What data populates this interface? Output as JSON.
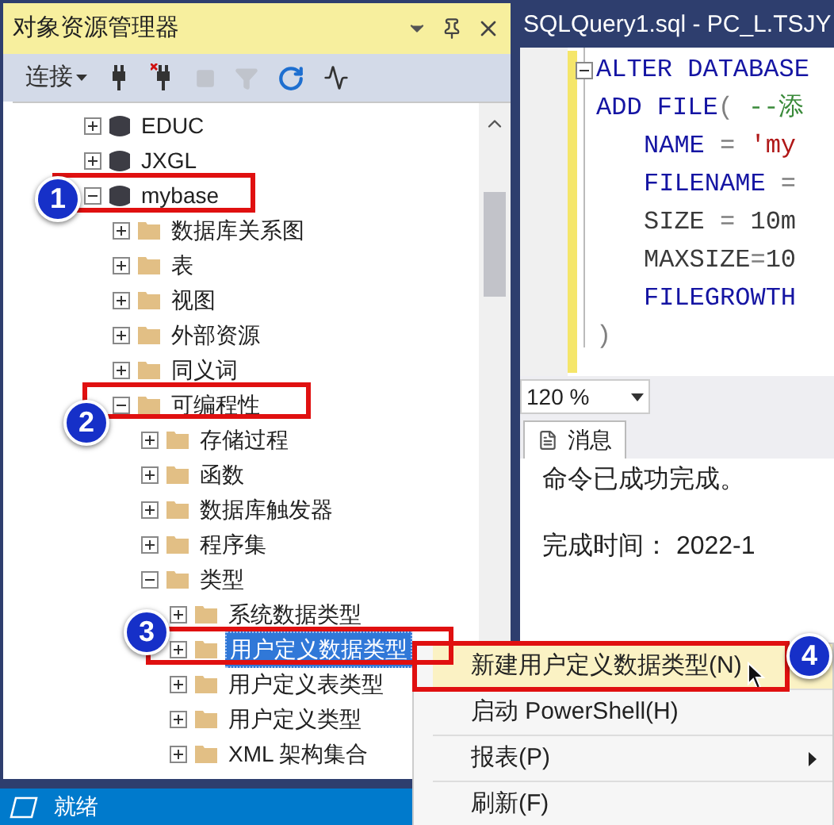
{
  "object_explorer": {
    "title": "对象资源管理器",
    "toolbar": {
      "connect_label": "连接",
      "tools": [
        {
          "kind": "connect",
          "disabled": false
        },
        {
          "kind": "disconnect",
          "disabled": false
        },
        {
          "kind": "stop",
          "disabled": true
        },
        {
          "kind": "filter",
          "disabled": true
        },
        {
          "kind": "refresh",
          "disabled": false
        },
        {
          "kind": "activity",
          "disabled": false
        }
      ]
    },
    "tree": [
      {
        "label": "EDUC",
        "kind": "database",
        "expanded": false,
        "selected": false
      },
      {
        "label": "JXGL",
        "kind": "database",
        "expanded": false,
        "selected": false
      },
      {
        "label": "mybase",
        "kind": "database",
        "expanded": true,
        "selected": false,
        "children": [
          {
            "label": "数据库关系图",
            "kind": "folder",
            "expanded": false,
            "selected": false
          },
          {
            "label": "表",
            "kind": "folder",
            "expanded": false,
            "selected": false
          },
          {
            "label": "视图",
            "kind": "folder",
            "expanded": false,
            "selected": false
          },
          {
            "label": "外部资源",
            "kind": "folder",
            "expanded": false,
            "selected": false
          },
          {
            "label": "同义词",
            "kind": "folder",
            "expanded": false,
            "selected": false
          },
          {
            "label": "可编程性",
            "kind": "folder",
            "expanded": true,
            "selected": false,
            "children": [
              {
                "label": "存储过程",
                "kind": "folder",
                "expanded": false,
                "selected": false
              },
              {
                "label": "函数",
                "kind": "folder",
                "expanded": false,
                "selected": false
              },
              {
                "label": "数据库触发器",
                "kind": "folder",
                "expanded": false,
                "selected": false
              },
              {
                "label": "程序集",
                "kind": "folder",
                "expanded": false,
                "selected": false
              },
              {
                "label": "类型",
                "kind": "folder",
                "expanded": true,
                "selected": false,
                "children": [
                  {
                    "label": "系统数据类型",
                    "kind": "folder",
                    "expanded": false,
                    "selected": false
                  },
                  {
                    "label": "用户定义数据类型",
                    "kind": "folder",
                    "expanded": false,
                    "selected": true
                  },
                  {
                    "label": "用户定义表类型",
                    "kind": "folder",
                    "expanded": false,
                    "selected": false
                  },
                  {
                    "label": "用户定义类型",
                    "kind": "folder",
                    "expanded": false,
                    "selected": false
                  },
                  {
                    "label": "XML 架构集合",
                    "kind": "folder",
                    "expanded": false,
                    "selected": false
                  }
                ]
              }
            ]
          }
        ]
      }
    ]
  },
  "editor": {
    "tab_title": "SQLQuery1.sql - PC_L.TSJY",
    "lines": [
      {
        "indented": false,
        "foldable": true,
        "segments": [
          {
            "kind": "keyword",
            "text": "ALTER DATABASE"
          }
        ]
      },
      {
        "indented": false,
        "foldable": false,
        "segments": [
          {
            "kind": "keyword",
            "text": "ADD FILE"
          },
          {
            "kind": "operator",
            "text": "( "
          },
          {
            "kind": "comment",
            "text": "--添"
          }
        ]
      },
      {
        "indented": true,
        "foldable": false,
        "segments": [
          {
            "kind": "keyword",
            "text": "NAME"
          },
          {
            "kind": "operator",
            "text": " = "
          },
          {
            "kind": "string",
            "text": "'my"
          }
        ]
      },
      {
        "indented": true,
        "foldable": false,
        "segments": [
          {
            "kind": "keyword",
            "text": "FILENAME"
          },
          {
            "kind": "operator",
            "text": " ="
          }
        ]
      },
      {
        "indented": true,
        "foldable": false,
        "segments": [
          {
            "kind": "plain",
            "text": "SIZE"
          },
          {
            "kind": "operator",
            "text": " = "
          },
          {
            "kind": "plain",
            "text": "10m"
          }
        ]
      },
      {
        "indented": true,
        "foldable": false,
        "segments": [
          {
            "kind": "plain",
            "text": "MAXSIZE"
          },
          {
            "kind": "operator",
            "text": "="
          },
          {
            "kind": "plain",
            "text": "10"
          }
        ]
      },
      {
        "indented": true,
        "foldable": false,
        "segments": [
          {
            "kind": "keyword",
            "text": "FILEGROWTH"
          }
        ]
      },
      {
        "indented": false,
        "foldable": false,
        "segments": [
          {
            "kind": "operator",
            "text": ")"
          }
        ]
      }
    ],
    "zoom": "120 %"
  },
  "results": {
    "tab": "消息",
    "messages": [
      "命令已成功完成。",
      "完成时间： 2022-1"
    ]
  },
  "context_menu": [
    {
      "label": "新建用户定义数据类型(N)",
      "selected": true,
      "submenu": false
    },
    {
      "label": "启动 PowerShell(H)",
      "selected": false,
      "submenu": false
    },
    {
      "label": "报表(P)",
      "selected": false,
      "submenu": true
    },
    {
      "label": "刷新(F)",
      "selected": false,
      "submenu": false
    }
  ],
  "status_bar": {
    "text": "就绪"
  },
  "callouts": [
    {
      "number": "1"
    },
    {
      "number": "2"
    },
    {
      "number": "3"
    },
    {
      "number": "4"
    }
  ]
}
